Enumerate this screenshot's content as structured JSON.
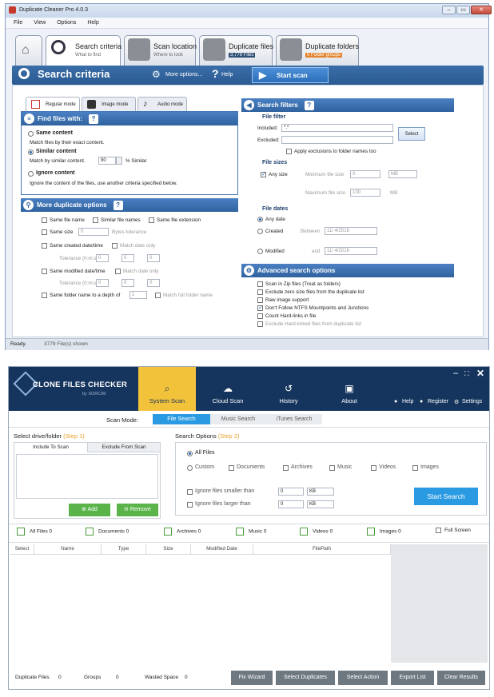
{
  "dc": {
    "title": "Duplicate Cleaner Pro 4.0.3",
    "menu": [
      "File",
      "View",
      "Options",
      "Help"
    ],
    "tabs": [
      {
        "label": "Search criteria",
        "sub": "What to find"
      },
      {
        "label": "Scan location",
        "sub": "Where to look"
      },
      {
        "label": "Duplicate files",
        "sub": "3,779 Files"
      },
      {
        "label": "Duplicate folders",
        "sub": "0 Folder groups"
      }
    ],
    "header": {
      "title": "Search criteria",
      "more": "More options...",
      "help": "Help",
      "scan": "Start scan"
    },
    "modes": [
      "Regular mode",
      "Image mode",
      "Audio mode"
    ],
    "find": {
      "title": "Find files with:",
      "same": "Same content",
      "same_desc": "Match files by their exact content.",
      "similar": "Similar content",
      "similar_desc": "Match by similar content.",
      "similar_val": "90",
      "similar_unit": "% Similar",
      "ignore": "Ignore content",
      "ignore_desc": "Ignore the content of the files, use another criteria specified below."
    },
    "more": {
      "title": "More duplicate options",
      "same_name": "Same file name",
      "similar_names": "Similar file names",
      "same_ext": "Same file extension",
      "same_size": "Same size",
      "size_val": "0",
      "bytes": "Bytes tolerance",
      "created": "Same created date/time",
      "match_date": "Match date only",
      "tolerance": "Tolerance (h:m:s)",
      "modified": "Same modified date/time",
      "folder": "Same folder name to a depth of",
      "depth": "1",
      "full": "Match full folder name",
      "tol_val": "0"
    },
    "filters": {
      "title": "Search filters",
      "file_filter": "File filter",
      "included": "Included:",
      "included_val": "*.*",
      "excluded": "Excluded:",
      "select": "Select",
      "apply": "Apply exclusions to folder names too",
      "sizes": "File sizes",
      "any_size": "Any size",
      "min": "Minimum file size",
      "min_val": "0",
      "mb": "MB",
      "max": "Maximum file size",
      "max_val": "100",
      "dates": "File dates",
      "any_date": "Any date",
      "created": "Created",
      "between": "Between",
      "date1": "11/ 4/2016",
      "modified": "Modified",
      "and": "and",
      "date2": "11/ 4/2016"
    },
    "advanced": {
      "title": "Advanced search options",
      "items": [
        "Scan in Zip files (Treat as folders)",
        "Exclude zero size files from the duplicate list",
        "Raw image support",
        "Don't Follow NTFS Mountpoints and Junctions",
        "Count Hard-links in file",
        "Exclude Hard-linked files from duplicate list"
      ]
    },
    "status": {
      "ready": "Ready.",
      "files": "3779 File(s) shown"
    }
  },
  "cfc": {
    "logo": "CLONE FILES CHECKER",
    "by": "by SORCIM",
    "nav": [
      "System Scan",
      "Cloud Scan",
      "History",
      "About"
    ],
    "links": [
      "Help",
      "Register",
      "Settings"
    ],
    "scan_mode": "Scan Mode:",
    "modes": [
      "File Search",
      "Music Search",
      "iTunes Search"
    ],
    "select_drive": "Select drive/folder",
    "step1": "(Step 1)",
    "include": "Include To Scan",
    "exclude": "Exclude From Scan",
    "add": "Add",
    "remove": "Remove",
    "search_options": "Search Options",
    "step2": "(Step 2)",
    "all_files": "All Files",
    "custom": "Custom",
    "types": [
      "Documents",
      "Archives",
      "Music",
      "Videos",
      "Images"
    ],
    "smaller": "Ignore files smaller than",
    "larger": "Ignore files larger than",
    "zero": "0",
    "kb": "KB",
    "start": "Start Search",
    "filters": [
      "All Files 0",
      "Documents 0",
      "Archives 0",
      "Music 0",
      "Videos 0",
      "Images 0"
    ],
    "fullscreen": "Full Screen",
    "columns": [
      "Select",
      "Name",
      "Type",
      "Size",
      "Modified Date",
      "FilePath"
    ],
    "footer": {
      "dup": "Duplicate Files",
      "dup_val": "0",
      "groups": "Groups",
      "groups_val": "0",
      "wasted": "Wasted Space",
      "wasted_val": "0"
    },
    "buttons": [
      "Fix Wizard",
      "Select Duplicates",
      "Select Action",
      "Export List",
      "Clear Results"
    ]
  }
}
